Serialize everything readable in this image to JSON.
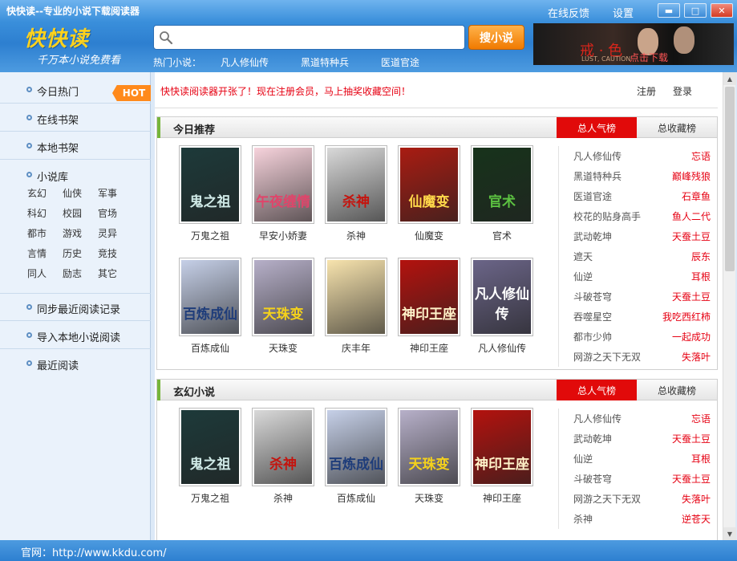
{
  "window": {
    "title": "快快读--专业的小说下载阅读器",
    "feedback": "在线反馈",
    "settings": "设置",
    "minimize_glyph": "▬",
    "maximize_glyph": "□",
    "close_glyph": "✕"
  },
  "brand": {
    "logo": "快快读",
    "slogan": "千万本小说免费看"
  },
  "search": {
    "placeholder": "",
    "button": "搜小说"
  },
  "hot_novels": {
    "label": "热门小说：",
    "items": [
      "凡人修仙传",
      "黑道特种兵",
      "医道官途"
    ]
  },
  "banner": {
    "title": "戒 · 色",
    "subtitle": "LUST, CAUTION",
    "click": "点击下载"
  },
  "sidebar": {
    "items": [
      {
        "label": "今日热门",
        "tag": "HOT"
      },
      {
        "label": "在线书架"
      },
      {
        "label": "本地书架"
      }
    ],
    "library": {
      "label": "小说库",
      "categories": [
        "玄幻",
        "仙侠",
        "军事",
        "科幻",
        "校园",
        "官场",
        "都市",
        "游戏",
        "灵异",
        "言情",
        "历史",
        "竞技",
        "同人",
        "励志",
        "其它"
      ]
    },
    "bottom_items": [
      "同步最近阅读记录",
      "导入本地小说阅读",
      "最近阅读"
    ]
  },
  "notice": {
    "text": "快快读阅读器开张了！现在注册会员，马上抽奖收藏空间！",
    "register": "注册",
    "login": "登录"
  },
  "sections": [
    {
      "title": "今日推荐",
      "tab_active": "总人气榜",
      "tab_inactive": "总收藏榜",
      "books": [
        "万鬼之祖",
        "早安小娇妻",
        "杀神",
        "仙魔变",
        "官术",
        "百炼成仙",
        "天珠变",
        "庆丰年",
        "神印王座",
        "凡人修仙传"
      ],
      "ranking": [
        {
          "book": "凡人修仙传",
          "author": "忘语"
        },
        {
          "book": "黑道特种兵",
          "author": "巅峰残狼"
        },
        {
          "book": "医道官途",
          "author": "石章鱼"
        },
        {
          "book": "校花的贴身高手",
          "author": "鱼人二代"
        },
        {
          "book": "武动乾坤",
          "author": "天蚕土豆"
        },
        {
          "book": "遮天",
          "author": "辰东"
        },
        {
          "book": "仙逆",
          "author": "耳根"
        },
        {
          "book": "斗破苍穹",
          "author": "天蚕土豆"
        },
        {
          "book": "吞噬星空",
          "author": "我吃西红柿"
        },
        {
          "book": "都市少帅",
          "author": "一起成功"
        },
        {
          "book": "网游之天下无双",
          "author": "失落叶"
        }
      ]
    },
    {
      "title": "玄幻小说",
      "tab_active": "总人气榜",
      "tab_inactive": "总收藏榜",
      "books": [
        "万鬼之祖",
        "杀神",
        "百炼成仙",
        "天珠变",
        "神印王座"
      ],
      "ranking": [
        {
          "book": "凡人修仙传",
          "author": "忘语"
        },
        {
          "book": "武动乾坤",
          "author": "天蚕土豆"
        },
        {
          "book": "仙逆",
          "author": "耳根"
        },
        {
          "book": "斗破苍穹",
          "author": "天蚕土豆"
        },
        {
          "book": "网游之天下无双",
          "author": "失落叶"
        },
        {
          "book": "杀神",
          "author": "逆苍天"
        }
      ]
    }
  ],
  "covers": {
    "万鬼之祖": {
      "bg": "#1d3a3a",
      "fg": "#cfe9e6",
      "text": "鬼之祖"
    },
    "早安小娇妻": {
      "bg": "#f7d3dc",
      "fg": "#e0446a",
      "text": "午夜缠情"
    },
    "杀神": {
      "bg": "#d9d9d9",
      "fg": "#c4140e",
      "text": "杀神"
    },
    "仙魔变": {
      "bg": "#a91c12",
      "fg": "#ffd84a",
      "text": "仙魔变"
    },
    "官术": {
      "bg": "#17331b",
      "fg": "#5cc241",
      "text": "官术"
    },
    "百炼成仙": {
      "bg": "#c6d0e8",
      "fg": "#1f3d7a",
      "text": "百炼成仙"
    },
    "天珠变": {
      "bg": "#b7b0c9",
      "fg": "#f4d11c",
      "text": "天珠变"
    },
    "庆丰年": {
      "bg": "#f8e4ae",
      "fg": "#4b2c22",
      "text": ""
    },
    "神印王座": {
      "bg": "#b3120e",
      "fg": "#fff2c9",
      "text": "神印王座"
    },
    "凡人修仙传": {
      "bg": "#6b6588",
      "fg": "#ffffff",
      "text": "凡人修仙传"
    }
  },
  "status": {
    "text": "官网：http://www.kkdu.com/"
  }
}
